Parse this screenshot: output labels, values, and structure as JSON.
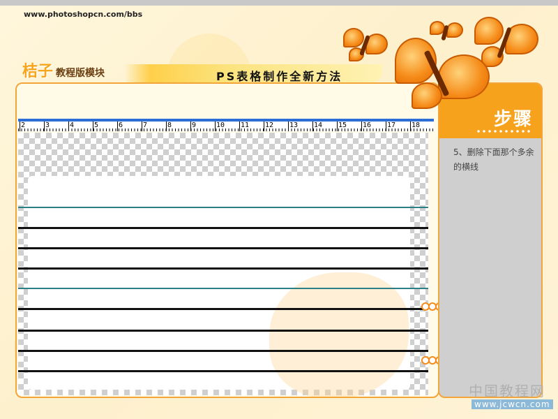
{
  "header": {
    "site_url": "www.photoshopcn.com/bbs",
    "brand_main": "桔子",
    "brand_sub": "教程版模块",
    "title": "PS表格制作全新方法"
  },
  "ruler": {
    "labels": [
      "2",
      "3",
      "4",
      "5",
      "6",
      "7",
      "8",
      "9",
      "10",
      "11",
      "12",
      "13",
      "14",
      "15",
      "16",
      "17",
      "18"
    ]
  },
  "sidebar": {
    "heading": "步骤",
    "step_text": "5、删除下面那个多余的横线"
  },
  "footer": {
    "watermark_text": "中国教程网",
    "watermark_url": "www.jcwcn.com"
  },
  "colors": {
    "accent": "#f7a21c",
    "ruler_bar": "#2c6ed5",
    "teal_line": "#2d7f86",
    "sidebar_bg": "#cfcfcf"
  },
  "icons": [
    "butterfly-icon",
    "ring-icon"
  ]
}
